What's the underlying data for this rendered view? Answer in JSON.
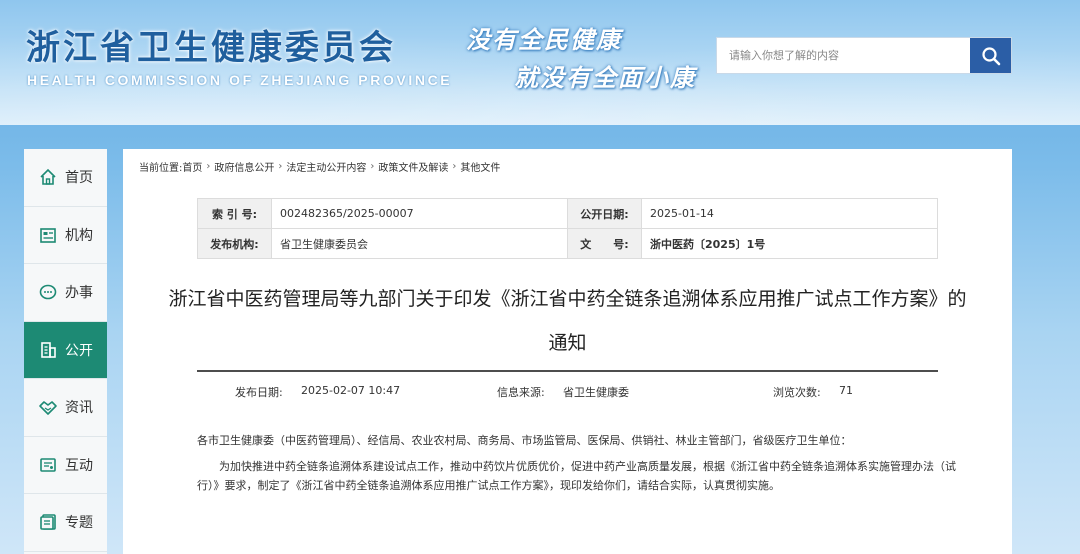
{
  "header": {
    "title": "浙江省卫生健康委员会",
    "subtitle": "HEALTH COMMISSION OF ZHEJIANG PROVINCE",
    "slogan_line1": "没有全民健康",
    "slogan_line2": "就没有全面小康",
    "search": {
      "placeholder": "请输入你想了解的内容",
      "button_icon": "search-icon"
    }
  },
  "sidebar": {
    "items": [
      {
        "label": "首页",
        "icon": "home-icon",
        "active": false
      },
      {
        "label": "机构",
        "icon": "organization-icon",
        "active": false
      },
      {
        "label": "办事",
        "icon": "chat-icon",
        "active": false
      },
      {
        "label": "公开",
        "icon": "building-icon",
        "active": true
      },
      {
        "label": "资讯",
        "icon": "handshake-icon",
        "active": false
      },
      {
        "label": "互动",
        "icon": "interaction-icon",
        "active": false
      },
      {
        "label": "专题",
        "icon": "topic-icon",
        "active": false
      }
    ],
    "active_color": "#1d8a74"
  },
  "breadcrumb": {
    "prefix": "当前位置:",
    "items": [
      "首页",
      "政府信息公开",
      "法定主动公开内容",
      "政策文件及解读",
      "其他文件"
    ],
    "separator": "›"
  },
  "meta": {
    "index_label": "索 引 号:",
    "index_value": "002482365/2025-00007",
    "publish_date_label": "公开日期:",
    "publish_date_value": "2025-01-14",
    "issuer_label": "发布机构:",
    "issuer_value": "省卫生健康委员会",
    "doc_no_label": "文　　号:",
    "doc_no_value": "浙中医药〔2025〕1号"
  },
  "document": {
    "title": "浙江省中医药管理局等九部门关于印发《浙江省中药全链条追溯体系应用推广试点工作方案》的通知",
    "release_time_label": "发布日期:",
    "release_time_value": "2025-02-07 10:47",
    "source_label": "信息来源:",
    "source_value": "省卫生健康委",
    "views_label": "浏览次数:",
    "views_value": "71",
    "paragraph1": "各市卫生健康委（中医药管理局）、经信局、农业农村局、商务局、市场监管局、医保局、供销社、林业主管部门，省级医疗卫生单位：",
    "paragraph2": "为加快推进中药全链条追溯体系建设试点工作，推动中药饮片优质优价，促进中药产业高质量发展，根据《浙江省中药全链条追溯体系实施管理办法（试行）》要求，制定了《浙江省中药全链条追溯体系应用推广试点工作方案》，现印发给你们，请结合实际，认真贯彻实施。"
  }
}
